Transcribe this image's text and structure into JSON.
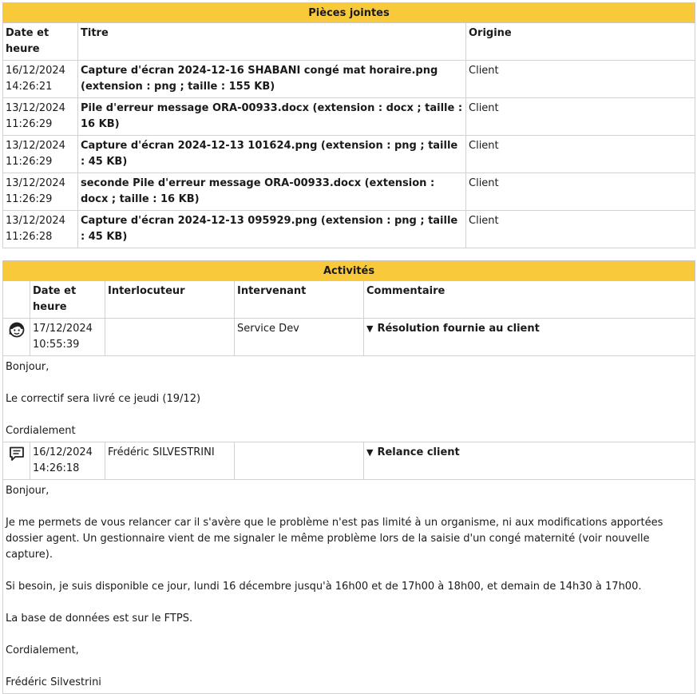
{
  "attachments": {
    "title": "Pièces jointes",
    "columns": [
      "Date et heure",
      "Titre",
      "Origine"
    ],
    "rows": [
      {
        "date": "16/12/2024",
        "time": "14:26:21",
        "title": "Capture d'écran 2024-12-16 SHABANI congé mat horaire.png (extension : png ; taille : 155 KB)",
        "origin": "Client"
      },
      {
        "date": "13/12/2024",
        "time": "11:26:29",
        "title": "Pile d'erreur message ORA-00933.docx (extension : docx ; taille : 16 KB)",
        "origin": "Client"
      },
      {
        "date": "13/12/2024",
        "time": "11:26:29",
        "title": "Capture d'écran 2024-12-13 101624.png (extension : png ; taille : 45 KB)",
        "origin": "Client"
      },
      {
        "date": "13/12/2024",
        "time": "11:26:29",
        "title": "seconde Pile d'erreur message ORA-00933.docx (extension : docx ; taille : 16 KB)",
        "origin": "Client"
      },
      {
        "date": "13/12/2024",
        "time": "11:26:28",
        "title": "Capture d'écran 2024-12-13 095929.png (extension : png ; taille : 45 KB)",
        "origin": "Client"
      }
    ]
  },
  "activities": {
    "title": "Activités",
    "columns": [
      "Date et heure",
      "Interlocuteur",
      "Intervenant",
      "Commentaire"
    ],
    "items": [
      {
        "icon": "support-agent-icon",
        "date": "17/12/2024",
        "time": "10:55:39",
        "interlocutor": "",
        "agent": "Service Dev",
        "subject": "Résolution fournie au client",
        "body": [
          "Bonjour,",
          "",
          "Le correctif sera livré ce jeudi (19/12)",
          "",
          "Cordialement"
        ]
      },
      {
        "icon": "message-icon",
        "date": "16/12/2024",
        "time": "14:26:18",
        "interlocutor": "Frédéric SILVESTRINI",
        "agent": "",
        "subject": "Relance client",
        "body": [
          "Bonjour,",
          "",
          "Je me permets de vous relancer car il s'avère que le problème n'est pas limité à un organisme, ni aux modifications apportées dossier agent. Un gestionnaire vient de me signaler le même problème lors de la saisie d'un congé maternité (voir nouvelle capture).",
          "",
          "Si besoin, je suis disponible ce jour, lundi 16 décembre jusqu'à 16h00 et de 17h00 à 18h00, et demain de 14h30 à 17h00.",
          "",
          "La base de données est sur le FTPS.",
          "",
          "Cordialement,",
          "",
          "Frédéric Silvestrini"
        ]
      }
    ]
  }
}
